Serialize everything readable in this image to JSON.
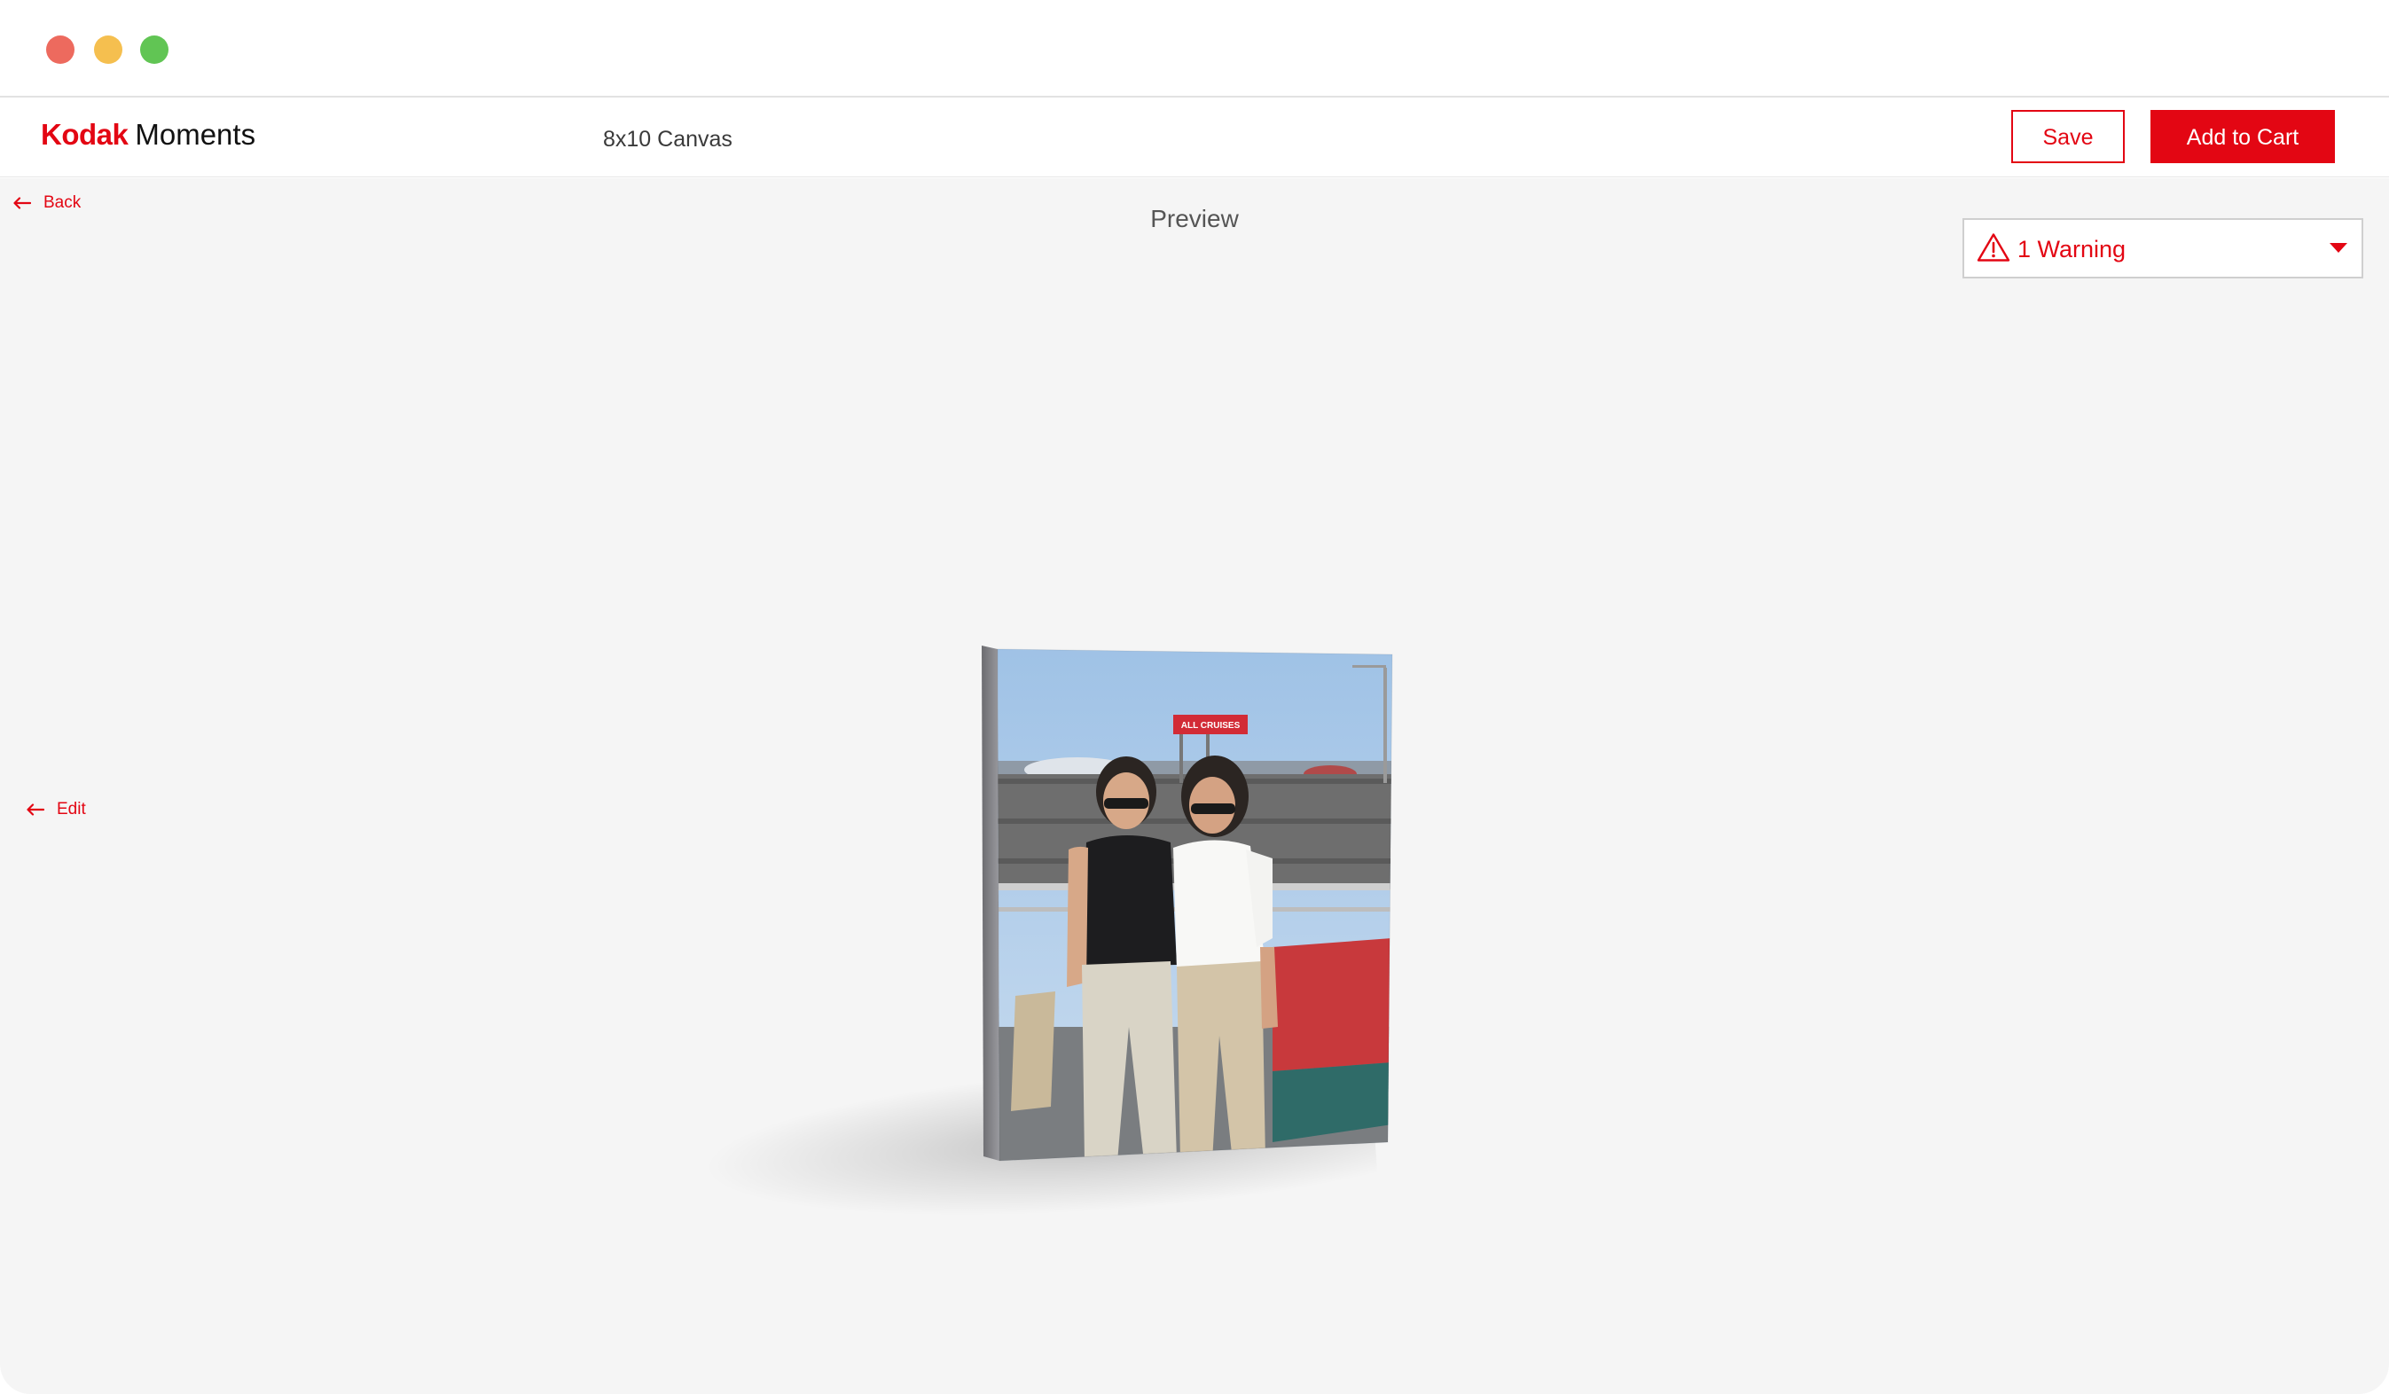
{
  "window": {
    "controls": [
      {
        "name": "close",
        "color": "#ed6a5e"
      },
      {
        "name": "minimize",
        "color": "#f5bf4f"
      },
      {
        "name": "zoom",
        "color": "#61c554"
      }
    ]
  },
  "header": {
    "brand_primary": "Kodak",
    "brand_secondary": "Moments",
    "product_name": "8x10 Canvas",
    "save_label": "Save",
    "add_to_cart_label": "Add to Cart"
  },
  "main": {
    "back_label": "Back",
    "edit_label": "Edit",
    "preview_title": "Preview",
    "warning_label": "1 Warning"
  },
  "photo": {
    "sign_text": "ALL CRUISES"
  },
  "colors": {
    "accent": "#e30613",
    "background": "#f5f5f5",
    "header_bg": "#ffffff"
  },
  "icons": {
    "back": "arrow-left-icon",
    "edit": "arrow-left-icon",
    "warning": "warning-triangle-icon",
    "dropdown": "caret-down-icon"
  }
}
